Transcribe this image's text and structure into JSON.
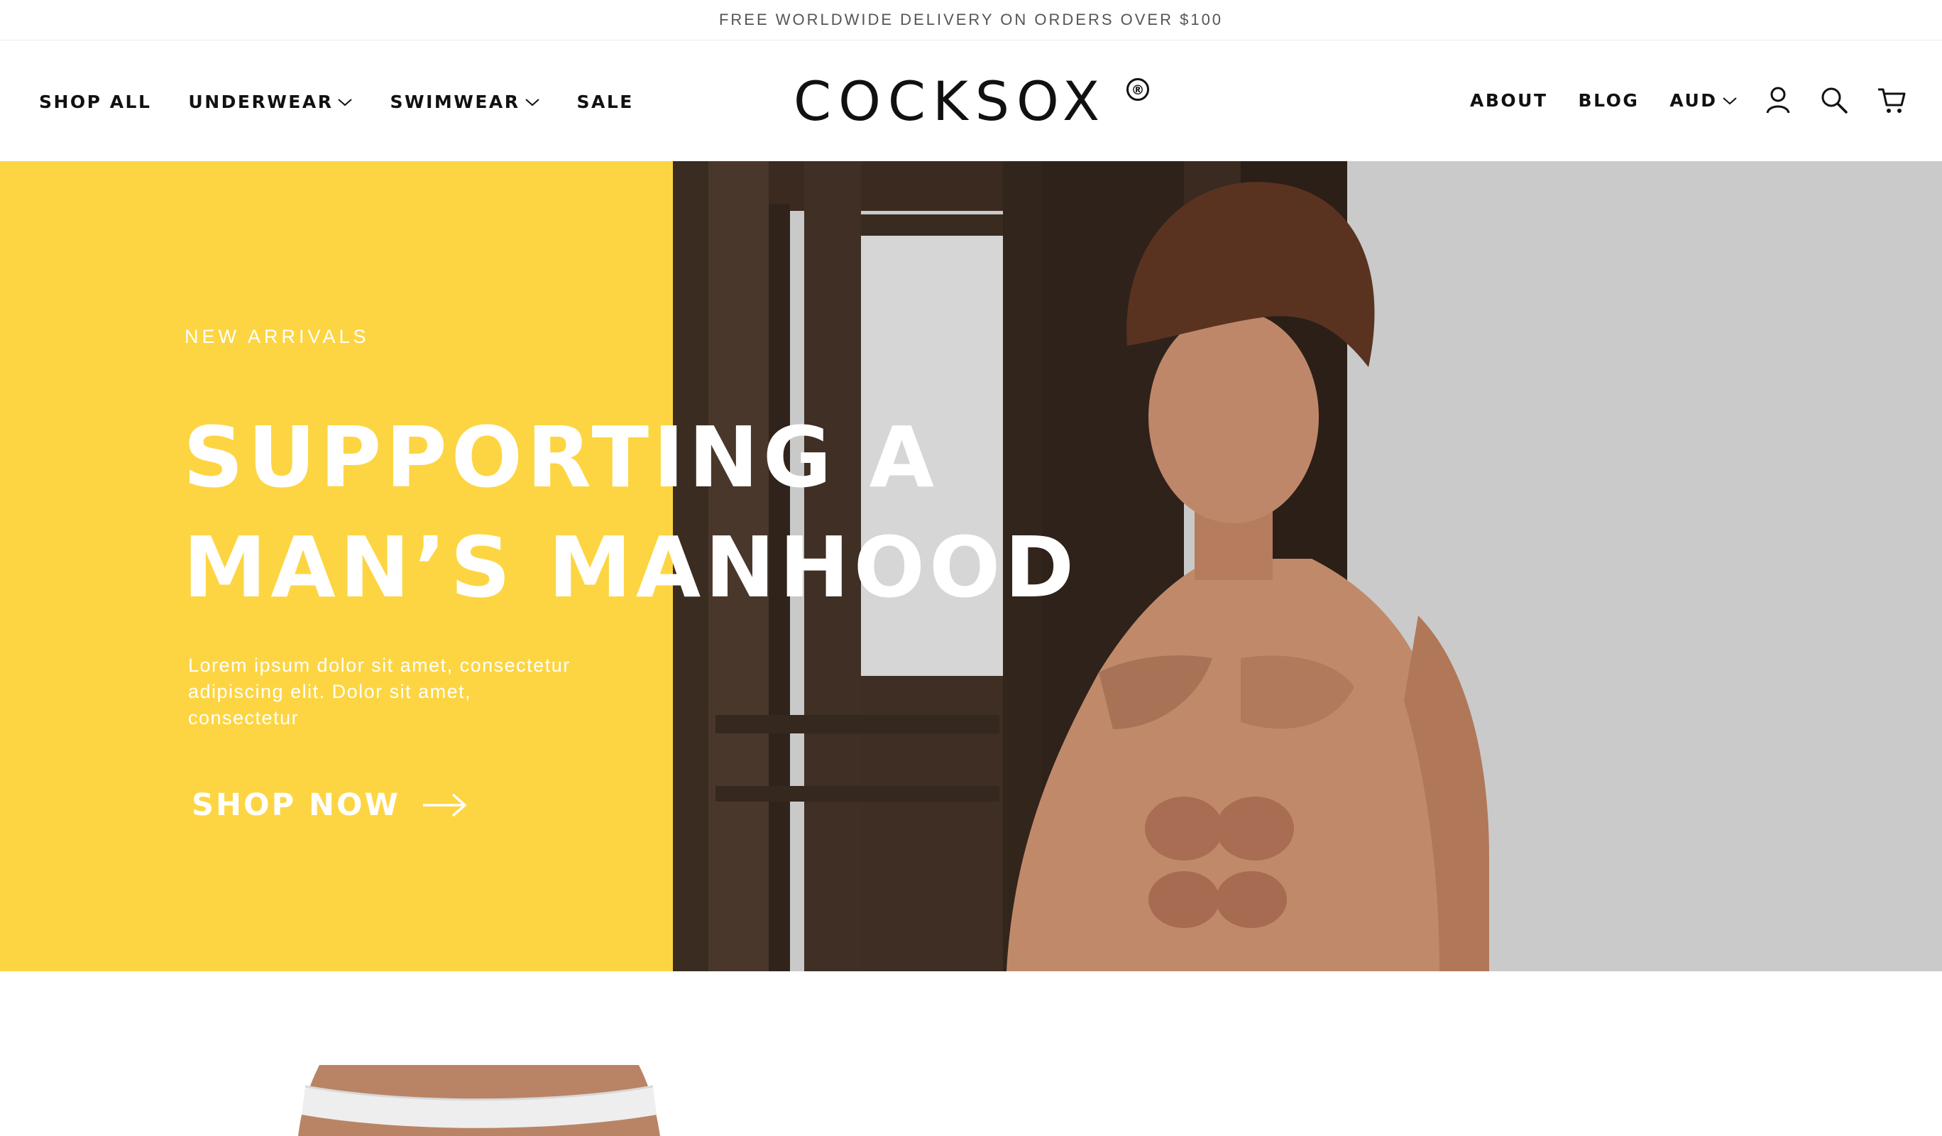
{
  "announcement": {
    "text": "FREE WORLDWIDE DELIVERY ON ORDERS OVER $100"
  },
  "brand": {
    "logo_text": "COCKSOX",
    "registered_mark": "®"
  },
  "nav_left": {
    "shop_all": "SHOP ALL",
    "underwear": "UNDERWEAR",
    "swimwear": "SWIMWEAR",
    "sale": "SALE"
  },
  "nav_right": {
    "about": "ABOUT",
    "blog": "BLOG",
    "currency": "AUD"
  },
  "icons": {
    "account": "user-icon",
    "search": "search-icon",
    "cart": "cart-icon"
  },
  "hero": {
    "eyebrow": "NEW ARRIVALS",
    "headline_line1": "SUPPORTING A",
    "headline_line2": "MAN’S MANHOOD",
    "description": "Lorem ipsum dolor sit amet, consectetur adipiscing elit. Dolor sit amet, consectetur",
    "cta_label": "SHOP NOW"
  },
  "colors": {
    "hero_yellow": "#fdd542",
    "hero_grey": "#cacaca",
    "text_dark": "#111111",
    "announcement_text": "#555555"
  }
}
